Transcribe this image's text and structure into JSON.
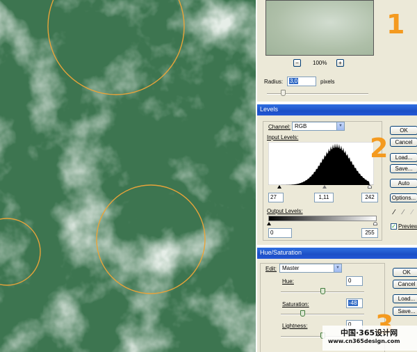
{
  "gaussian_blur": {
    "zoom": "100%",
    "zoom_out": "−",
    "zoom_in": "+",
    "radius_label": "Radius:",
    "radius_value": "3,0",
    "radius_unit": "pixels",
    "step_number": "1"
  },
  "levels": {
    "title": "Levels",
    "channel_label": "Channel:",
    "channel_value": "RGB",
    "input_label": "Input Levels:",
    "input_black": "27",
    "input_gamma": "1,11",
    "input_white": "242",
    "output_label": "Output Levels:",
    "output_black": "0",
    "output_white": "255",
    "buttons": {
      "ok": "OK",
      "cancel": "Cancel",
      "load": "Load...",
      "save": "Save...",
      "auto": "Auto",
      "options": "Options..."
    },
    "preview_label": "Preview",
    "preview_checked": true,
    "step_number": "2"
  },
  "hue_saturation": {
    "title": "Hue/Saturation",
    "edit_label": "Edit:",
    "edit_value": "Master",
    "hue_label": "Hue:",
    "hue_value": "0",
    "saturation_label": "Saturation:",
    "saturation_value": "-48",
    "lightness_label": "Lightness:",
    "lightness_value": "0",
    "buttons": {
      "ok": "OK",
      "cancel": "Cancel",
      "load": "Load...",
      "save": "Save..."
    },
    "step_number": "3"
  },
  "watermark": {
    "site_cn": "中国·365设计网",
    "site_url": "www.cn365design.com"
  },
  "colors": {
    "accent_orange": "#f49a1f",
    "cloud_dark_green": "#3f7a4e",
    "cloud_light": "#e8efe9"
  }
}
